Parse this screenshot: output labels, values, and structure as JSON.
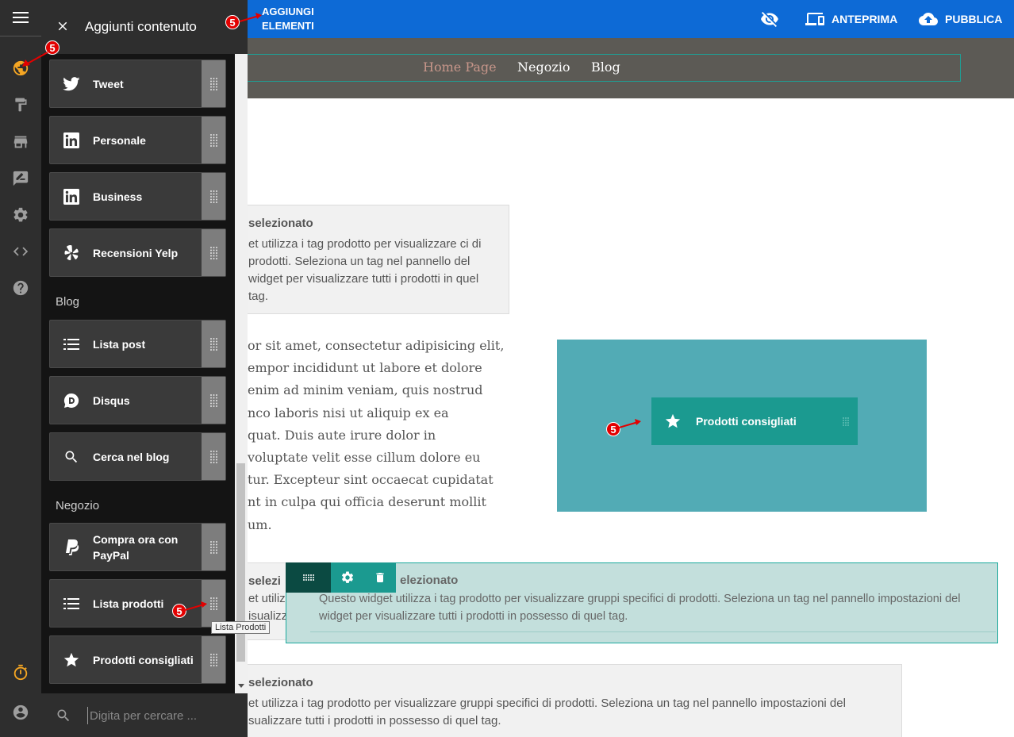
{
  "topbar": {
    "add_elements_line1": "AGGIUNGI",
    "add_elements_line2": "ELEMENTI",
    "preview_label": "ANTEPRIMA",
    "publish_label": "PUBBLICA"
  },
  "site_nav": {
    "items": [
      "Home Page",
      "Negozio",
      "Blog"
    ]
  },
  "panel": {
    "title": "Aggiunti contenuto",
    "items_social": [
      {
        "label": "Tweet",
        "icon": "twitter-icon"
      },
      {
        "label": "Personale",
        "icon": "linkedin-icon"
      },
      {
        "label": "Business",
        "icon": "linkedin-icon"
      },
      {
        "label": "Recensioni Yelp",
        "icon": "yelp-icon"
      }
    ],
    "section_blog": "Blog",
    "items_blog": [
      {
        "label": "Lista post",
        "icon": "list-icon"
      },
      {
        "label": "Disqus",
        "icon": "disqus-icon"
      },
      {
        "label": "Cerca nel blog",
        "icon": "search-icon"
      }
    ],
    "section_shop": "Negozio",
    "items_shop": [
      {
        "label": "Compra ora con PayPal",
        "icon": "paypal-icon"
      },
      {
        "label": "Lista prodotti",
        "icon": "list-icon"
      },
      {
        "label": "Prodotti consigliati",
        "icon": "star-icon"
      }
    ],
    "search_placeholder": "Digita per cercare ..."
  },
  "tooltip": "Lista Prodotti",
  "content": {
    "card1_title": "selezionato",
    "card1_text": "et utilizza i tag prodotto per visualizzare ci di prodotti. Seleziona un tag nel pannello del widget per visualizzare tutti i prodotti in quel tag.",
    "lorem": "or sit amet, consectetur adipisicing elit,\nempor incididunt ut labore et dolore\n enim ad minim veniam, quis nostrud\nnco laboris nisi ut aliquip ex ea\nquat. Duis aute irure dolor in\nvoluptate velit esse cillum dolore eu\ntur. Excepteur sint occaecat cupidatat\nnt in culpa qui officia deserunt mollit\num.",
    "drag_widget_label": "Prodotti consigliati",
    "behind_title": "selezi",
    "behind_line1": "et utiliz",
    "behind_line2": "isualizz",
    "selected_title": "elezionato",
    "selected_text": "Questo widget utilizza i tag prodotto per visualizzare gruppi specifici di prodotti. Seleziona un tag nel pannello impostazioni del widget per visualizzare tutti i prodotti in possesso di quel tag.",
    "card3_title": "selezionato",
    "card3_line1": "et utilizza i tag prodotto per visualizzare gruppi specifici di prodotti. Seleziona un tag nel pannello impostazioni del",
    "card3_line2": "sualizzare tutti i prodotti in possesso di quel tag."
  },
  "badges": {
    "callout_number": "5"
  },
  "colors": {
    "topbar": "#0d6ad6",
    "rail": "#2e2e2e",
    "panel": "#141414",
    "teal": "#1b9a90",
    "accent_globe": "#f5a623",
    "badge": "#e30000"
  }
}
